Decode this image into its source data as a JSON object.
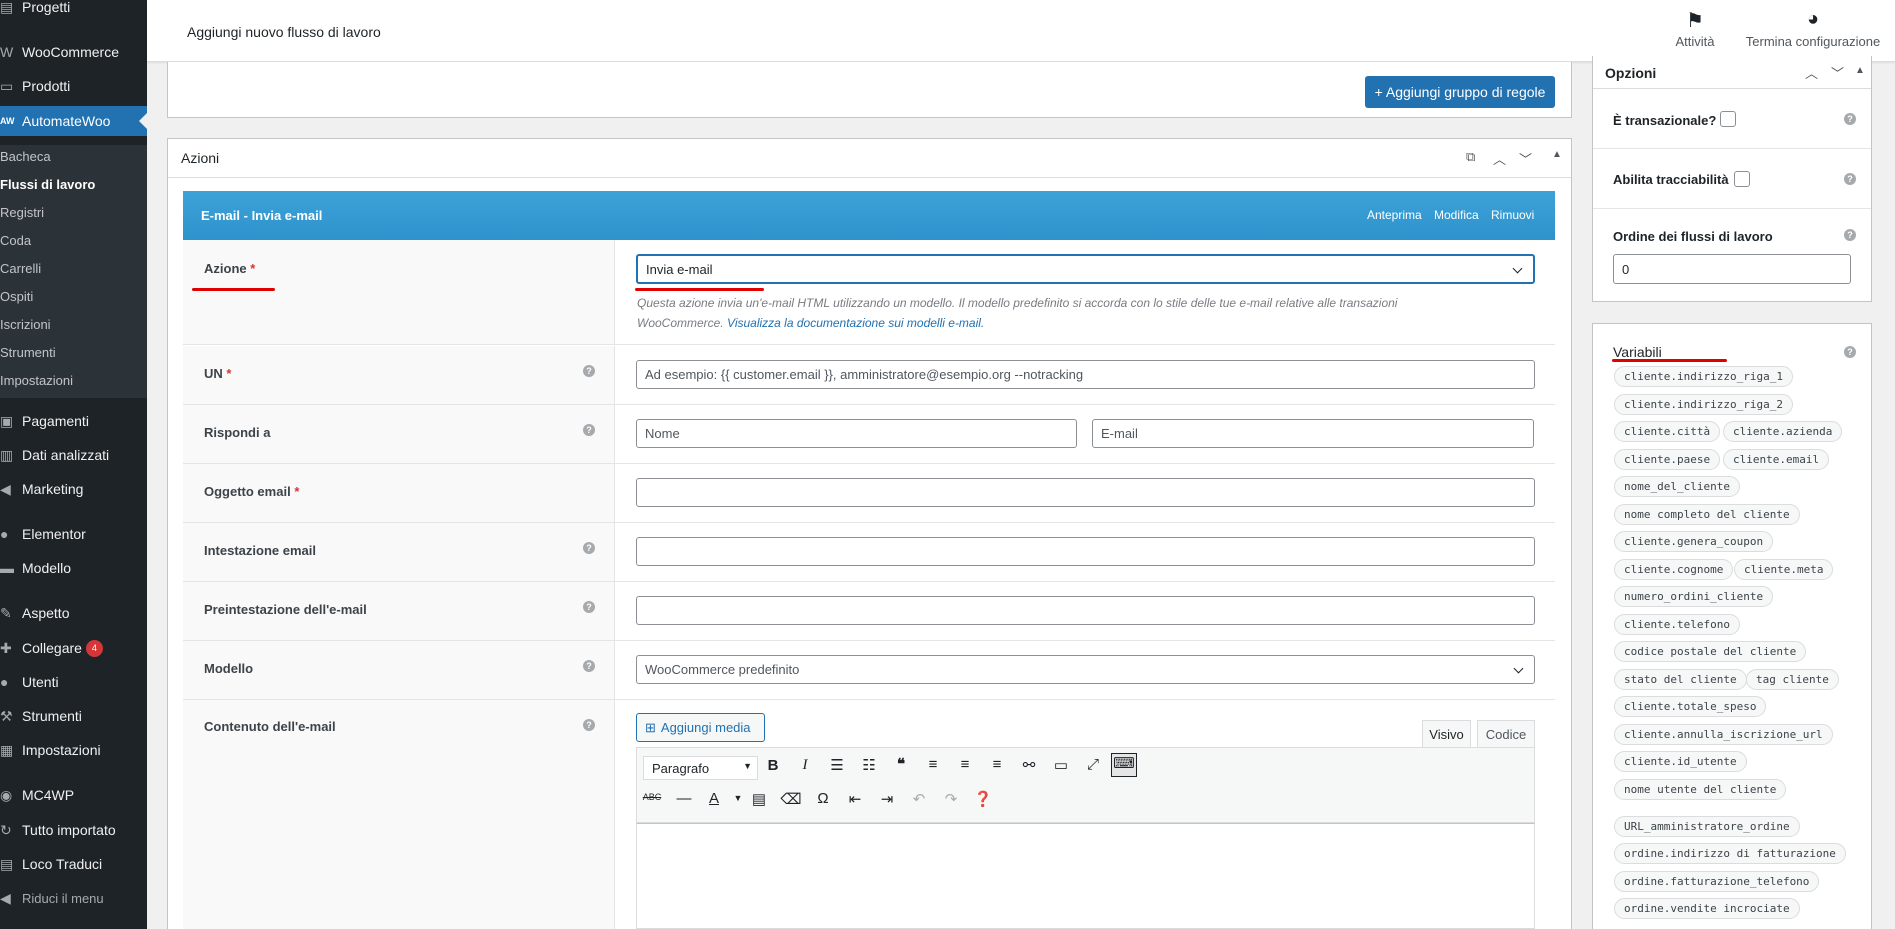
{
  "sidebar": {
    "items": [
      {
        "label": "Progetti",
        "icon": "grid-icon"
      },
      {
        "label": "WooCommerce",
        "icon": "woo-icon"
      },
      {
        "label": "Prodotti",
        "icon": "box-icon"
      },
      {
        "label": "AutomateWoo",
        "icon": "aw-logo",
        "icon_text": "AW"
      },
      {
        "label": "Pagamenti",
        "icon": "payment-icon"
      },
      {
        "label": "Dati analizzati",
        "icon": "chart-icon"
      },
      {
        "label": "Marketing",
        "icon": "megaphone-icon"
      },
      {
        "label": "Elementor",
        "icon": "elementor-icon"
      },
      {
        "label": "Modello",
        "icon": "folder-icon"
      },
      {
        "label": "Aspetto",
        "icon": "brush-icon"
      },
      {
        "label": "Collegare",
        "icon": "plugin-icon",
        "badge": "4"
      },
      {
        "label": "Utenti",
        "icon": "user-icon"
      },
      {
        "label": "Strumenti",
        "icon": "wrench-icon"
      },
      {
        "label": "Impostazioni",
        "icon": "settings-icon"
      },
      {
        "label": "MC4WP",
        "icon": "mc4wp-icon"
      },
      {
        "label": "Tutto importato",
        "icon": "import-icon"
      },
      {
        "label": "Loco Traduci",
        "icon": "translate-icon"
      },
      {
        "label": "Riduci il menu",
        "icon": "collapse-icon"
      }
    ],
    "submenu": [
      "Bacheca",
      "Flussi di lavoro",
      "Registri",
      "Coda",
      "Carrelli",
      "Ospiti",
      "Iscrizioni",
      "Strumenti",
      "Impostazioni"
    ]
  },
  "header": {
    "title": "Aggiungi nuovo flusso di lavoro",
    "activity_label": "Attività",
    "finish_setup_label": "Termina configurazione"
  },
  "rules": {
    "add_group_label": "+ Aggiungi gruppo di regole"
  },
  "actions": {
    "title": "Azioni",
    "bar_title": "E-mail - Invia e-mail",
    "preview_label": "Anteprima",
    "edit_label": "Modifica",
    "remove_label": "Rimuovi",
    "action_label": "Azione",
    "action_value": "Invia e-mail",
    "action_desc": "Questa azione invia un'e-mail HTML utilizzando un modello. Il modello predefinito si accorda con lo stile delle tue e-mail relative alle transazioni",
    "action_desc_2": "WooCommerce.",
    "action_desc_link": "Visualizza la documentazione sui modelli e-mail.",
    "to_label": "UN",
    "to_placeholder": "Ad esempio: {{ customer.email }}, amministratore@esempio.org --notracking",
    "reply_label": "Rispondi a",
    "reply_name_placeholder": "Nome",
    "reply_email_placeholder": "E-mail",
    "subject_label": "Oggetto email",
    "heading_label": "Intestazione email",
    "preheader_label": "Preintestazione dell'e-mail",
    "template_label": "Modello",
    "template_value": "WooCommerce predefinito",
    "content_label": "Contenuto dell'e-mail",
    "add_media_label": "Aggiungi media",
    "tab_visual": "Visivo",
    "tab_code": "Codice",
    "paragraph_label": "Paragrafo",
    "required_mark": "*",
    "help_mark": "?"
  },
  "options": {
    "title": "Opzioni",
    "transactional_label": "È transazionale?",
    "tracking_label": "Abilita tracciabilità",
    "order_label": "Ordine dei flussi di lavoro",
    "order_value": "0"
  },
  "variables": {
    "title": "Variabili",
    "tags": [
      "cliente.indirizzo_riga_1",
      "cliente.indirizzo_riga_2",
      "cliente.città",
      "cliente.azienda",
      "cliente.paese",
      "cliente.email",
      "nome_del_cliente",
      "nome completo del cliente",
      "cliente.genera_coupon",
      "cliente.cognome",
      "cliente.meta",
      "numero_ordini_cliente",
      "cliente.telefono",
      "codice postale del cliente",
      "stato del cliente",
      "tag cliente",
      "cliente.totale_speso",
      "cliente.annulla_iscrizione_url",
      "cliente.id_utente",
      "nome utente del cliente",
      "URL_amministratore_ordine",
      "ordine.indirizzo di fatturazione",
      "ordine.fatturazione_telefono",
      "ordine.vendite incrociate"
    ]
  },
  "colors": {
    "accent": "#2271b1",
    "action_bar": "#2e93cc",
    "sidebar_bg": "#1d2327",
    "annotation_red": "#e00000"
  }
}
